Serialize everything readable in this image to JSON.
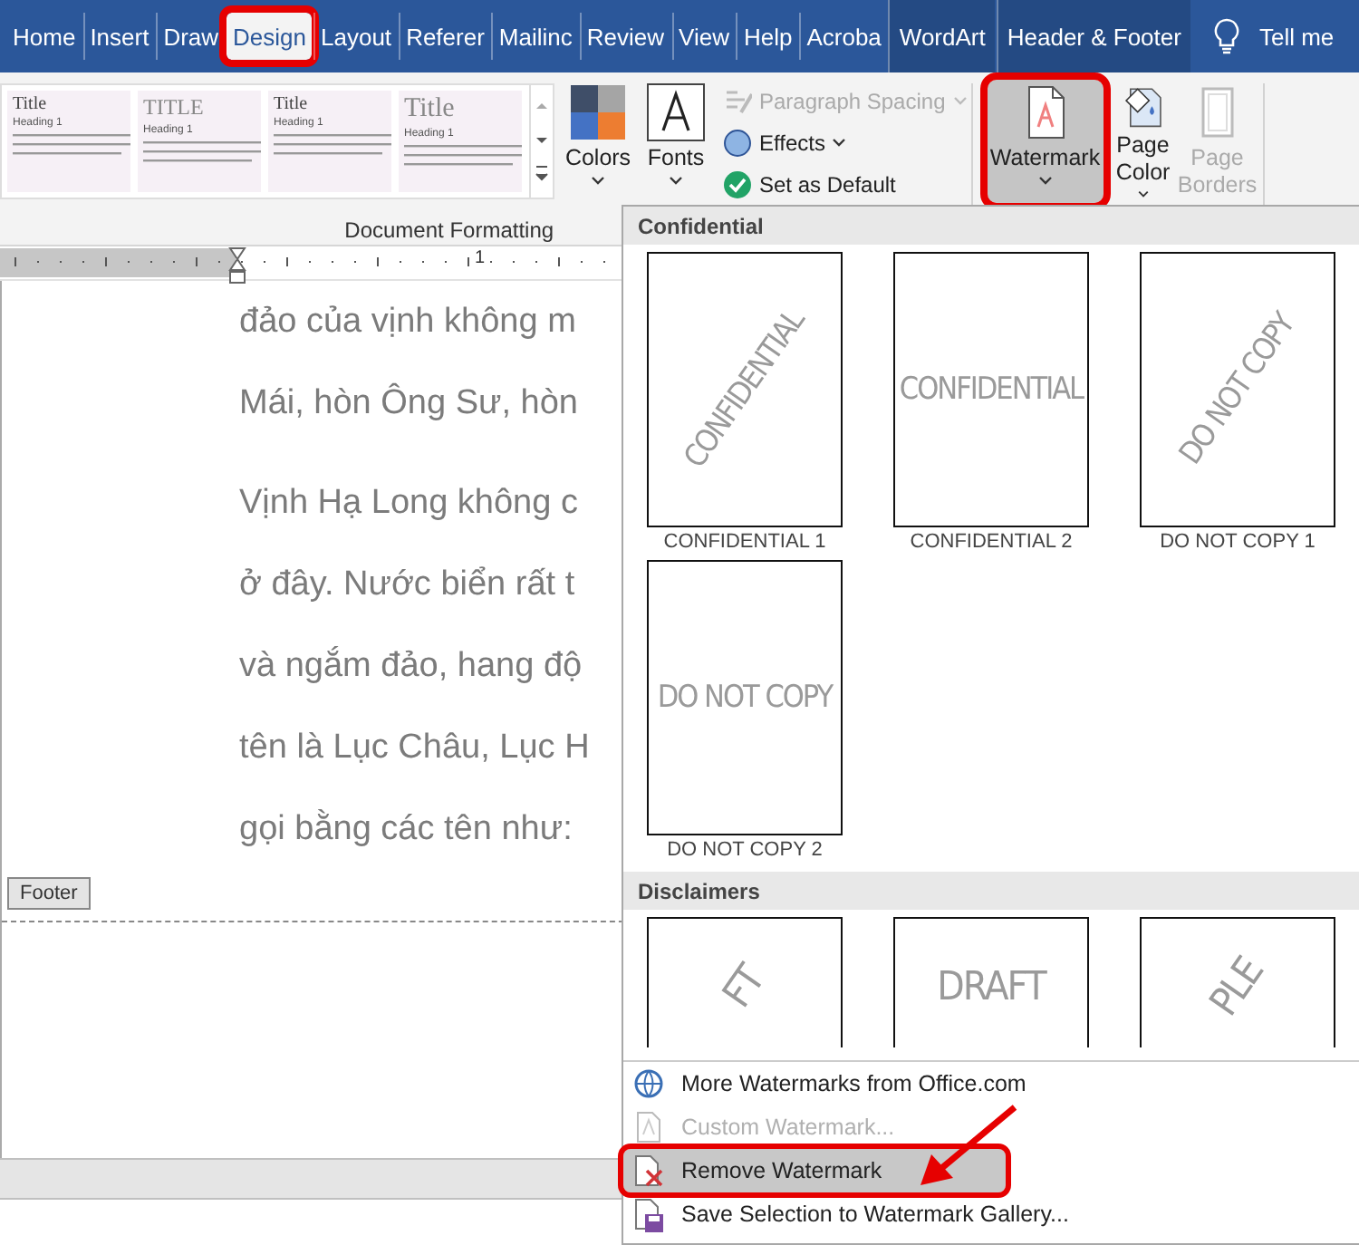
{
  "tabs": [
    {
      "label": "Home",
      "selected": false,
      "contextual": false,
      "marked": false
    },
    {
      "label": "Insert",
      "selected": false,
      "contextual": false,
      "marked": false
    },
    {
      "label": "Draw",
      "selected": false,
      "contextual": false,
      "marked": false
    },
    {
      "label": "Design",
      "selected": true,
      "contextual": false,
      "marked": true
    },
    {
      "label": "Layout",
      "selected": false,
      "contextual": false,
      "marked": false
    },
    {
      "label": "Referer",
      "selected": false,
      "contextual": false,
      "marked": false
    },
    {
      "label": "Mailinc",
      "selected": false,
      "contextual": false,
      "marked": false
    },
    {
      "label": "Review",
      "selected": false,
      "contextual": false,
      "marked": false
    },
    {
      "label": "View",
      "selected": false,
      "contextual": false,
      "marked": false
    },
    {
      "label": "Help",
      "selected": false,
      "contextual": false,
      "marked": false
    },
    {
      "label": "Acroba",
      "selected": false,
      "contextual": false,
      "marked": false
    },
    {
      "label": "WordArt",
      "selected": false,
      "contextual": true,
      "marked": false
    },
    {
      "label": "Header & Footer",
      "selected": false,
      "contextual": true,
      "marked": false
    }
  ],
  "tell_me": "Tell me",
  "ribbon": {
    "styles": [
      {
        "title": "Title",
        "heading": "Heading 1",
        "kind": "plain"
      },
      {
        "title": "TITLE",
        "heading": "Heading 1",
        "kind": "caps"
      },
      {
        "title": "Title",
        "heading": "Heading 1",
        "kind": "plain"
      },
      {
        "title": "Title",
        "heading": "Heading 1",
        "kind": "large"
      }
    ],
    "large_left": [
      {
        "label": "Colors",
        "disabled": false,
        "pressed": false,
        "marked": false
      },
      {
        "label": "Fonts",
        "disabled": false,
        "pressed": false,
        "marked": false
      }
    ],
    "small": [
      {
        "label": "Paragraph Spacing",
        "disabled": true,
        "caret": true
      },
      {
        "label": "Effects",
        "disabled": false,
        "caret": true
      },
      {
        "label": "Set as Default",
        "disabled": false,
        "caret": false
      }
    ],
    "large_right": [
      {
        "label": "Watermark",
        "disabled": false,
        "pressed": true,
        "marked": true
      },
      {
        "label": "Page Color",
        "disabled": false,
        "pressed": false,
        "marked": false
      },
      {
        "label": "Page Borders",
        "disabled": true,
        "pressed": false,
        "marked": false
      }
    ],
    "group_label": "Document Formatting"
  },
  "ruler": {
    "mark": "1"
  },
  "document": {
    "paragraphs": [
      [
        "đảo của vịnh không m",
        "Mái, hòn Ông Sư, hòn"
      ],
      [
        "Vịnh Hạ Long không c",
        "ở đây. Nước biển rất t",
        "và ngắm đảo, hang độ",
        "tên là Lục Châu, Lục H",
        "gọi bằng các tên như:"
      ]
    ],
    "footer_tag": "Footer"
  },
  "watermark_menu": {
    "sections": [
      {
        "title": "Confidential",
        "cut": false,
        "items": [
          {
            "label": "CONFIDENTIAL 1",
            "text": "CONFIDENTIAL",
            "kind": "diagonal"
          },
          {
            "label": "CONFIDENTIAL 2",
            "text": "CONFIDENTIAL",
            "kind": "horizontal"
          },
          {
            "label": "DO NOT COPY 1",
            "text": "DO NOT COPY",
            "kind": "diagonal"
          },
          {
            "label": "DO NOT COPY 2",
            "text": "DO NOT COPY",
            "kind": "horizontal"
          }
        ]
      },
      {
        "title": "Disclaimers",
        "cut": true,
        "items": [
          {
            "text": "FT",
            "kind": "diagonal"
          },
          {
            "text": "DRAFT",
            "kind": "horizontal"
          },
          {
            "text": "PLE",
            "kind": "diagonal"
          }
        ]
      }
    ],
    "commands": [
      {
        "label": "More Watermarks from Office.com",
        "disabled": false,
        "highlighted": false,
        "marked": false
      },
      {
        "label": "Custom Watermark...",
        "disabled": true,
        "highlighted": false,
        "marked": false
      },
      {
        "label": "Remove Watermark",
        "disabled": false,
        "highlighted": true,
        "marked": true
      },
      {
        "label": "Save Selection to Watermark Gallery...",
        "disabled": false,
        "highlighted": false,
        "marked": false
      }
    ]
  }
}
